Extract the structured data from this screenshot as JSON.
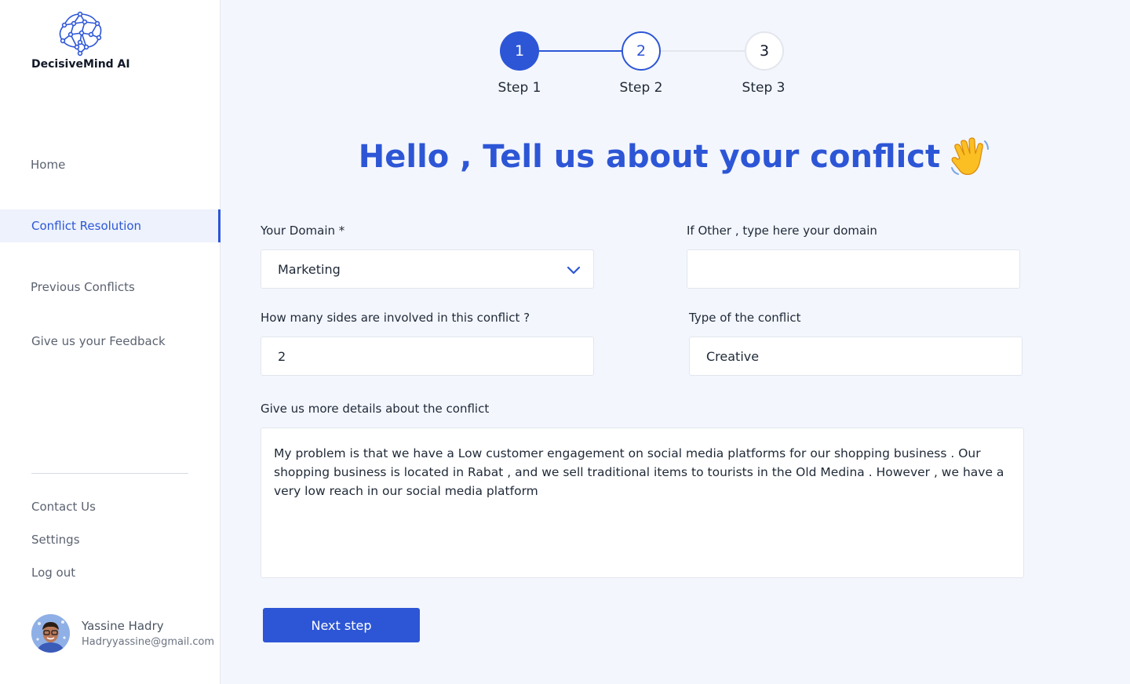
{
  "brand": {
    "name": "DecisiveMind AI",
    "logo_icon": "brain-network-icon",
    "accent_color": "#2d56d6"
  },
  "sidebar": {
    "nav_items": [
      {
        "label": "Home",
        "active": false
      },
      {
        "label": "Conflict Resolution",
        "active": true
      },
      {
        "label": "Previous Conflicts",
        "active": false
      },
      {
        "label": "Give us your Feedback",
        "active": false
      }
    ],
    "bottom_links": [
      "Contact Us",
      "Settings",
      "Log out"
    ],
    "user": {
      "name": "Yassine Hadry",
      "email": "Hadryyassine@gmail.com"
    }
  },
  "stepper": {
    "current_step": 2,
    "steps": [
      {
        "number": "1",
        "label": "Step 1",
        "state": "completed"
      },
      {
        "number": "2",
        "label": "Step 2",
        "state": "current"
      },
      {
        "number": "3",
        "label": "Step 3",
        "state": "upcoming"
      }
    ]
  },
  "main": {
    "heading": "Hello , Tell us about your conflict",
    "heading_icon": "waving-hand-icon",
    "form": {
      "domain": {
        "label": "Your Domain *",
        "value": "Marketing"
      },
      "other_domain": {
        "label": "If Other , type here your domain",
        "value": ""
      },
      "sides": {
        "label": "How many sides are involved in this conflict ?",
        "value": "2"
      },
      "conflict_type": {
        "label": "Type of the conflict",
        "value": "Creative"
      },
      "details": {
        "label": "Give us more details about the conflict",
        "value": "My problem is that we have a Low customer engagement on social media platforms for our shopping business . Our shopping business is located in Rabat , and we sell traditional items to tourists in the Old Medina . However , we have a very low reach in our social media platform"
      },
      "submit_label": "Next step"
    }
  }
}
